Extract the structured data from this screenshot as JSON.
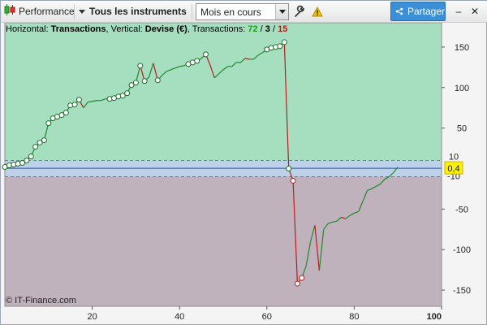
{
  "toolbar": {
    "performance_label": "Performance",
    "instrument_label": "Tous les instruments",
    "period_value": "Mois en cours",
    "share_label": "Partager",
    "minimize_symbol": "–",
    "close_symbol": "✕"
  },
  "icons": {
    "performance": "candlestick-chart-icon",
    "instrument_dropdown": "triangle-down-icon",
    "period_dropdown": "chevron-down-icon",
    "settings": "wrench-icon",
    "warning": "warning-triangle-icon",
    "share": "share-icon"
  },
  "colors": {
    "positive_zone": "#a6dfc0",
    "negative_zone": "#c0b2bd",
    "neutral_band": "#bdd2e8",
    "gain_line": "#1d8a2a",
    "loss_line": "#b81d1d",
    "marker_fill": "#ffffff",
    "marker_stroke": "#1f6b2a",
    "current_value_bg": "#fff200",
    "wins_color": "#17a317",
    "losses_color": "#cc1111",
    "share_button": "#3a8fd6"
  },
  "info": {
    "horizontal_label": "Horizontal: ",
    "horizontal_value": "Transactions",
    "vertical_label": ", Vertical: ",
    "vertical_value": "Devise (€)",
    "transactions_label": ", Transactions: ",
    "wins": "72",
    "sep1": " / ",
    "neutral": "3",
    "sep2": " / ",
    "losses": "15"
  },
  "watermark": "© IT-Finance.com",
  "current_value_label": "0,4",
  "neutral_band_labels": {
    "upper": "10",
    "lower": "-10"
  },
  "chart_data": {
    "type": "line",
    "title": "",
    "xlabel": "Transactions",
    "ylabel": "Devise (€)",
    "xlim": [
      0,
      100
    ],
    "ylim": [
      -170,
      180
    ],
    "x_ticks": [
      20,
      40,
      60,
      80,
      100
    ],
    "y_ticks": [
      150,
      100,
      50,
      -50,
      -100,
      -150
    ],
    "neutral_band": [
      -10,
      10
    ],
    "current_value": 0.4,
    "x": [
      0,
      1,
      2,
      3,
      4,
      5,
      6,
      7,
      8,
      9,
      10,
      11,
      12,
      13,
      14,
      15,
      16,
      17,
      18,
      19,
      20,
      21,
      22,
      23,
      24,
      25,
      26,
      27,
      28,
      29,
      30,
      31,
      32,
      33,
      34,
      35,
      36,
      37,
      38,
      39,
      40,
      41,
      42,
      43,
      44,
      45,
      46,
      47,
      48,
      49,
      50,
      51,
      52,
      53,
      54,
      55,
      56,
      57,
      58,
      59,
      60,
      61,
      62,
      63,
      64,
      65,
      66,
      67,
      68,
      69,
      70,
      71,
      72,
      73,
      74,
      75,
      76,
      77,
      78,
      79,
      80,
      81,
      82,
      83,
      84,
      85,
      86,
      87,
      88,
      89,
      90
    ],
    "y": [
      2,
      4,
      5,
      6,
      7,
      10,
      15,
      27,
      32,
      35,
      56,
      62,
      64,
      66,
      69,
      78,
      79,
      85,
      75,
      82,
      83,
      84,
      84,
      86,
      86,
      87,
      89,
      90,
      93,
      103,
      106,
      127,
      108,
      113,
      130,
      109,
      115,
      120,
      122,
      124,
      126,
      127,
      129,
      131,
      133,
      136,
      141,
      128,
      112,
      117,
      122,
      126,
      126,
      131,
      131,
      136,
      135,
      135,
      140,
      143,
      147,
      149,
      150,
      151,
      156,
      0,
      -15,
      -142,
      -135,
      -120,
      -90,
      -70,
      -126,
      -75,
      -68,
      -66,
      -65,
      -60,
      -62,
      -58,
      -55,
      -53,
      -40,
      -27,
      -25,
      -22,
      -19,
      -13,
      -10,
      -5,
      2
    ],
    "markers_x": [
      0,
      1,
      2,
      3,
      4,
      5,
      6,
      7,
      8,
      9,
      10,
      11,
      12,
      13,
      14,
      15,
      16,
      17,
      24,
      25,
      26,
      27,
      28,
      29,
      30,
      31,
      32,
      35,
      42,
      43,
      44,
      46,
      60,
      61,
      62,
      63,
      64,
      65,
      66,
      67,
      68
    ]
  }
}
